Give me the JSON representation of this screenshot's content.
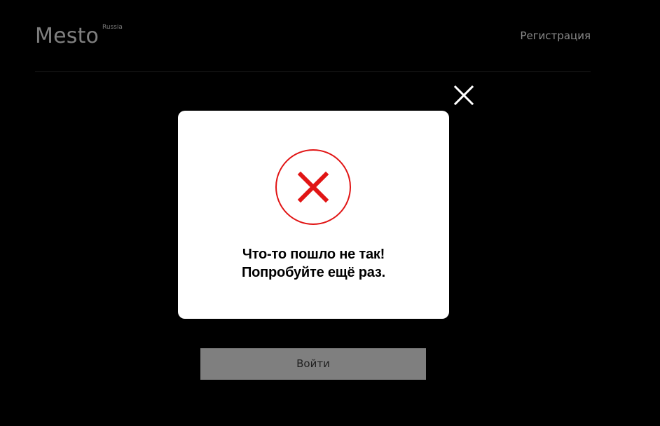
{
  "header": {
    "logo": "Mesto",
    "logo_superscript": "Russia",
    "nav_link": "Регистрация"
  },
  "login": {
    "button_label": "Войти"
  },
  "modal": {
    "message_line_1": "Что-то пошло не так!",
    "message_line_2": "Попробуйте ещё раз.",
    "status": "error",
    "icon": "error-x-circle-icon",
    "close_icon": "close-icon"
  },
  "colors": {
    "background": "#000000",
    "modal_background": "#ffffff",
    "error_red": "#e11515",
    "button_background": "#7f7f7f",
    "muted_text": "#7f7f7f"
  }
}
